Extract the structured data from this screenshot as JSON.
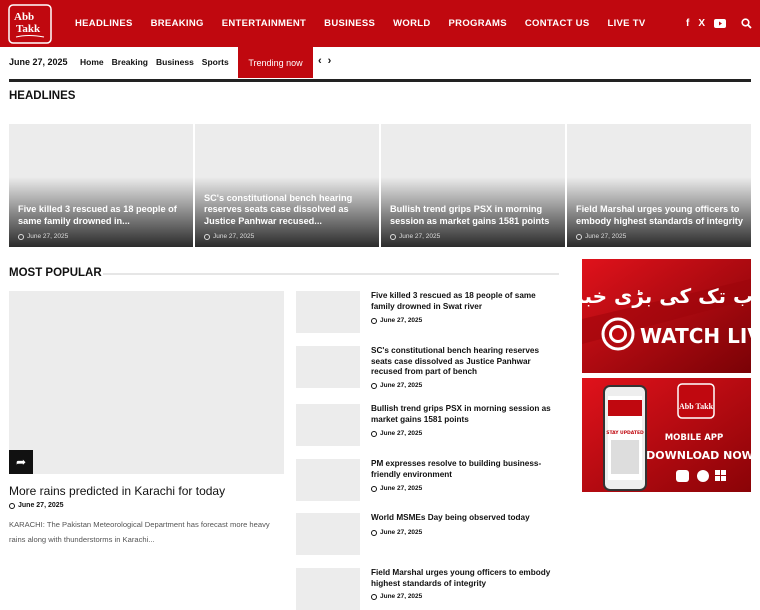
{
  "brand": {
    "logo_text_top": "Abb",
    "logo_text_bottom": "Takk",
    "color": "#c0080f"
  },
  "nav": {
    "items": [
      "HEADLINES",
      "BREAKING",
      "ENTERTAINMENT",
      "BUSINESS",
      "WORLD",
      "PROGRAMS",
      "CONTACT US",
      "LIVE TV"
    ]
  },
  "social": {
    "facebook": "f",
    "x": "X",
    "youtube": "▶"
  },
  "subbar": {
    "date": "June 27, 2025",
    "links": [
      "Home",
      "Breaking",
      "Business",
      "Sports"
    ],
    "trending": "Trending now"
  },
  "headlines": {
    "title": "HEADLINES",
    "cards": [
      {
        "title": "Five killed 3 rescued as 18 people of same family drowned in...",
        "date": "June 27, 2025"
      },
      {
        "title": "SC's constitutional bench hearing reserves seats case dissolved as Justice Panhwar recused...",
        "date": "June 27, 2025"
      },
      {
        "title": "Bullish trend grips PSX in morning session as market gains 1581 points",
        "date": "June 27, 2025"
      },
      {
        "title": "Field Marshal urges young officers to embody highest standards of integrity",
        "date": "June 27, 2025"
      }
    ]
  },
  "popular": {
    "title": "MOST POPULAR",
    "featured": {
      "title": "More rains predicted in Karachi for today",
      "date": "June 27, 2025",
      "excerpt": "KARACHI: The Pakistan Meteorological Department has forecast more heavy rains along with thunderstorms in Karachi..."
    },
    "items": [
      {
        "title": "Five killed 3 rescued as 18 people of same family drowned in Swat river",
        "date": "June 27, 2025"
      },
      {
        "title": "SC's constitutional bench hearing reserves seats case dissolved as Justice Panhwar recused from part of bench",
        "date": "June 27, 2025"
      },
      {
        "title": "Bullish trend grips PSX in morning session as market gains 1581 points",
        "date": "June 27, 2025"
      },
      {
        "title": "PM expresses resolve to building business-friendly environment",
        "date": "June 27, 2025"
      },
      {
        "title": "World MSMEs Day being observed today",
        "date": "June 27, 2025"
      },
      {
        "title": "Field Marshal urges young officers to embody highest standards of integrity",
        "date": "June 27, 2025"
      }
    ]
  },
  "ads": {
    "watch_live": {
      "urdu": "اب تک کی بڑی خبر",
      "label": "WATCH LIVE"
    },
    "app": {
      "brand": "Abb Takk",
      "mobile": "MOBILE APP",
      "download": "DOWNLOAD NOW",
      "screen": "STAY UPDATED"
    }
  }
}
